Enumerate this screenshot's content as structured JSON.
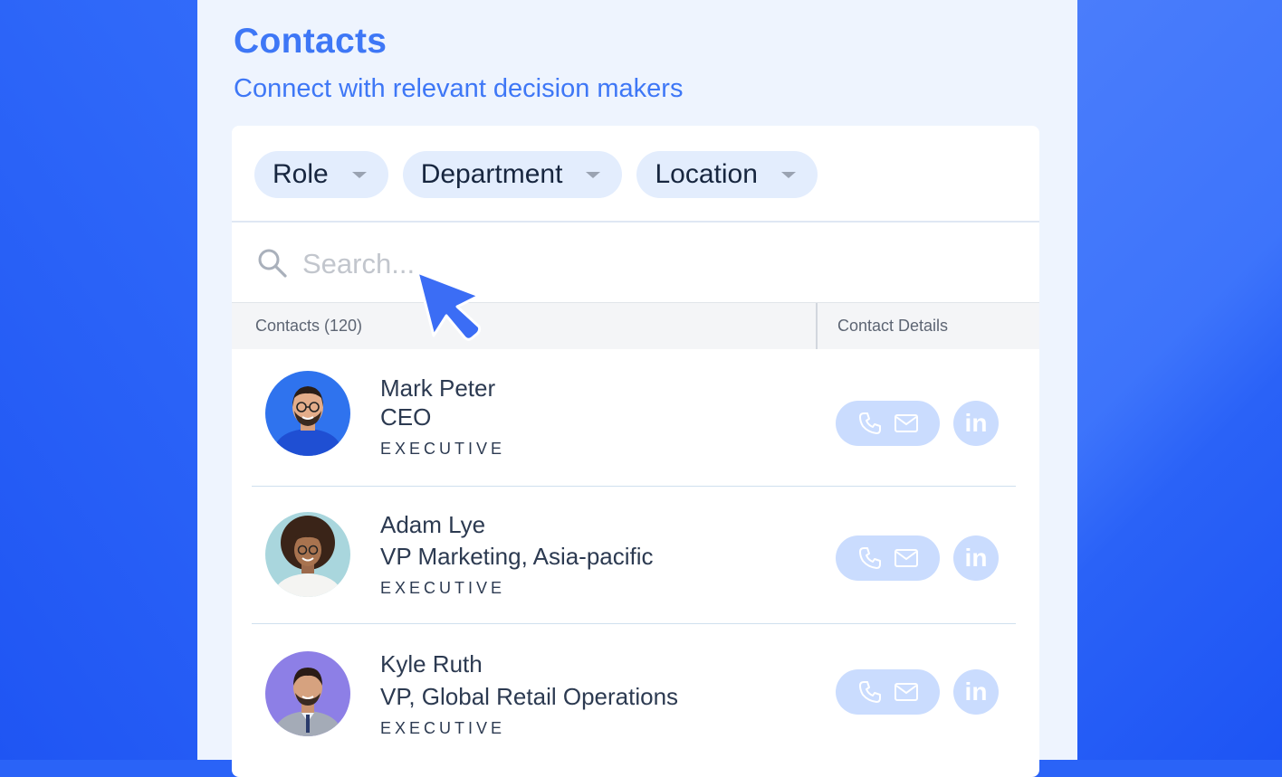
{
  "header": {
    "title": "Contacts",
    "subtitle": "Connect with relevant decision makers"
  },
  "filters": [
    {
      "label": "Role"
    },
    {
      "label": "Department"
    },
    {
      "label": "Location"
    }
  ],
  "search": {
    "value": "",
    "placeholder": "Search..."
  },
  "table": {
    "contacts_header": "Contacts (120)",
    "details_header": "Contact Details"
  },
  "contacts": [
    {
      "name": "Mark Peter",
      "title": "CEO",
      "level": "EXECUTIVE",
      "linkedin_label": "in"
    },
    {
      "name": "Adam Lye",
      "title": "VP Marketing, Asia-pacific",
      "level": "EXECUTIVE",
      "linkedin_label": "in"
    },
    {
      "name": "Kyle Ruth",
      "title": "VP, Global Retail Operations",
      "level": "EXECUTIVE",
      "linkedin_label": "in"
    }
  ],
  "colors": {
    "accent": "#3e77f6",
    "panel_bg": "#eef4fe",
    "chip_bg": "#e3edfd",
    "action_bg": "#cadcfe",
    "text_dark": "#2c3a51"
  },
  "icons": [
    "search-icon",
    "caret-down-icon",
    "phone-icon",
    "mail-icon",
    "linkedin-icon",
    "cursor-arrow-icon"
  ]
}
